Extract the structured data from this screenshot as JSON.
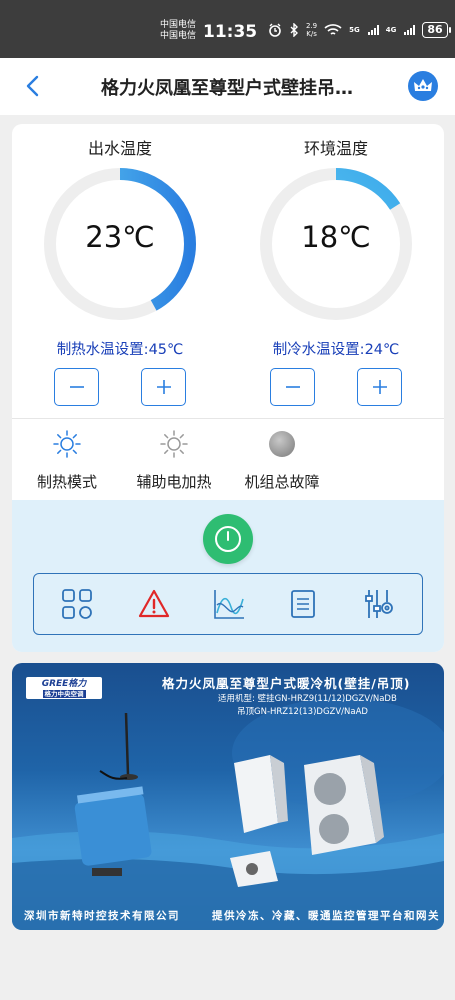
{
  "status_bar": {
    "carrier_1": "中国电信",
    "carrier_2": "中国电信",
    "time": "11:35",
    "speed_value": "2.9",
    "speed_unit": "K/s",
    "network_1": "5G",
    "network_2": "4G",
    "battery": "86"
  },
  "header": {
    "title": "格力火凤凰至尊型户式壁挂吊…"
  },
  "gauges": {
    "outlet": {
      "title": "出水温度",
      "value": "23℃",
      "fill_fraction": 0.42,
      "setting": "制热水温设置:45℃"
    },
    "ambient": {
      "title": "环境温度",
      "value": "18℃",
      "fill_fraction": 0.16,
      "setting": "制冷水温设置:24℃"
    }
  },
  "modes": {
    "heating": "制热模式",
    "aux_heat": "辅助电加热",
    "fault": "机组总故障"
  },
  "banner": {
    "logo_brand": "GREE格力",
    "logo_sub": "格力中央空调",
    "title": "格力火凤凰至尊型户式暖冷机(壁挂/吊顶)",
    "models_line1": "适用机型: 壁挂GN-HRZ9(11/12)DGZV/NaDB",
    "models_line2": "吊顶GN-HRZ12(13)DGZV/NaAD",
    "footer_left": "深圳市新特时控技术有限公司",
    "footer_right": "提供冷冻、冷藏、暖通监控管理平台和网关"
  },
  "colors": {
    "accent": "#2a7ee0",
    "setting_text": "#1a40b8",
    "power": "#2ebd72",
    "alert": "#e02828",
    "panel_bg": "#dff0fa"
  }
}
